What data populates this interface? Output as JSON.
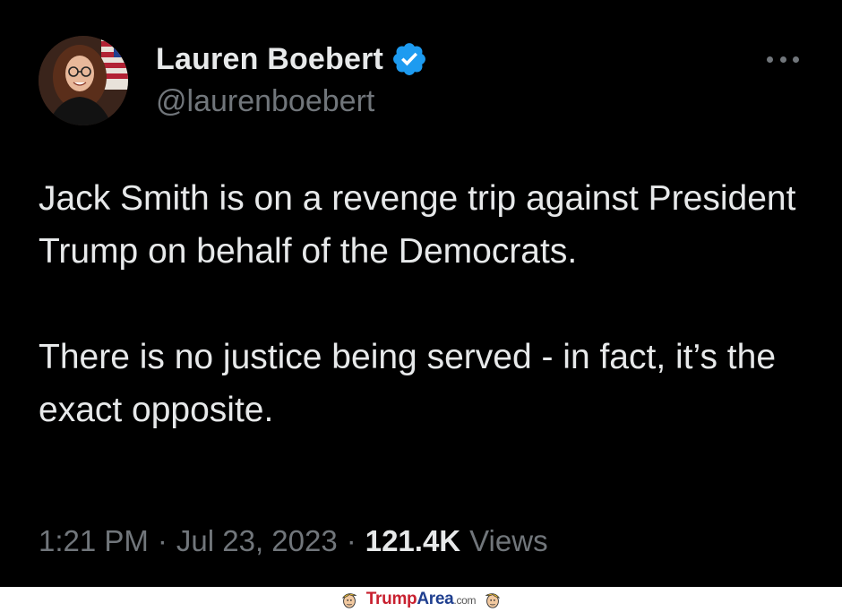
{
  "tweet": {
    "author": {
      "display_name": "Lauren Boebert",
      "handle": "@laurenboebert",
      "verified": true
    },
    "paragraphs": [
      "Jack Smith is on a revenge trip against President Trump on behalf of the Democrats.",
      "There is no justice being served - in fact, it’s the exact opposite."
    ],
    "meta": {
      "time": "1:21 PM",
      "separator": "·",
      "date": "Jul 23, 2023",
      "views_count": "121.4K",
      "views_label": "Views"
    },
    "more_icon": "more-horizontal-icon"
  },
  "watermark": {
    "brand_part1": "Trump",
    "brand_part2": "Area",
    "brand_part3": ".com"
  },
  "colors": {
    "background": "#000000",
    "text_primary": "#e7e9ea",
    "text_secondary": "#71767b",
    "verified_blue": "#1d9bf0",
    "brand_red": "#c8202f",
    "brand_blue": "#1f3f8f"
  }
}
